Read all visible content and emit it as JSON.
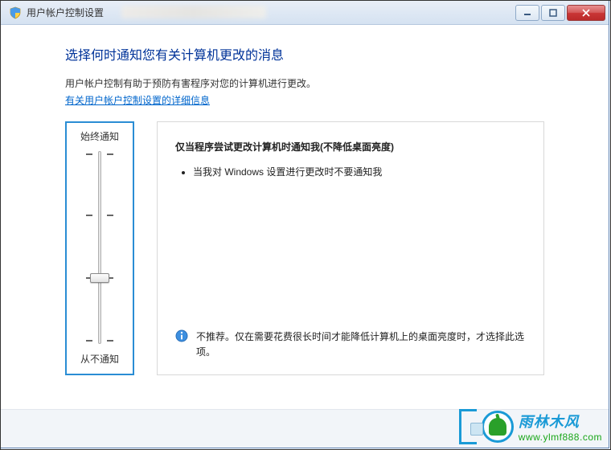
{
  "window": {
    "title": "用户帐户控制设置",
    "min_label": "minimize",
    "max_label": "maximize",
    "close_label": "close"
  },
  "header": {
    "heading": "选择何时通知您有关计算机更改的消息",
    "description": "用户帐户控制有助于预防有害程序对您的计算机进行更改。",
    "link": "有关用户帐户控制设置的详细信息"
  },
  "slider": {
    "top_label": "始终通知",
    "bottom_label": "从不通知",
    "levels": 4,
    "value_index": 2
  },
  "info": {
    "title": "仅当程序尝试更改计算机时通知我(不降低桌面亮度)",
    "bullet_1": "当我对 Windows 设置进行更改时不要通知我",
    "note": "不推荐。仅在需要花费很长时间才能降低计算机上的桌面亮度时，才选择此选项。"
  },
  "watermark": {
    "brand": "雨林木风",
    "url": "www.ylmf888.com"
  },
  "colors": {
    "accent": "#1a9ad6",
    "heading": "#003399",
    "link": "#0066cc"
  }
}
